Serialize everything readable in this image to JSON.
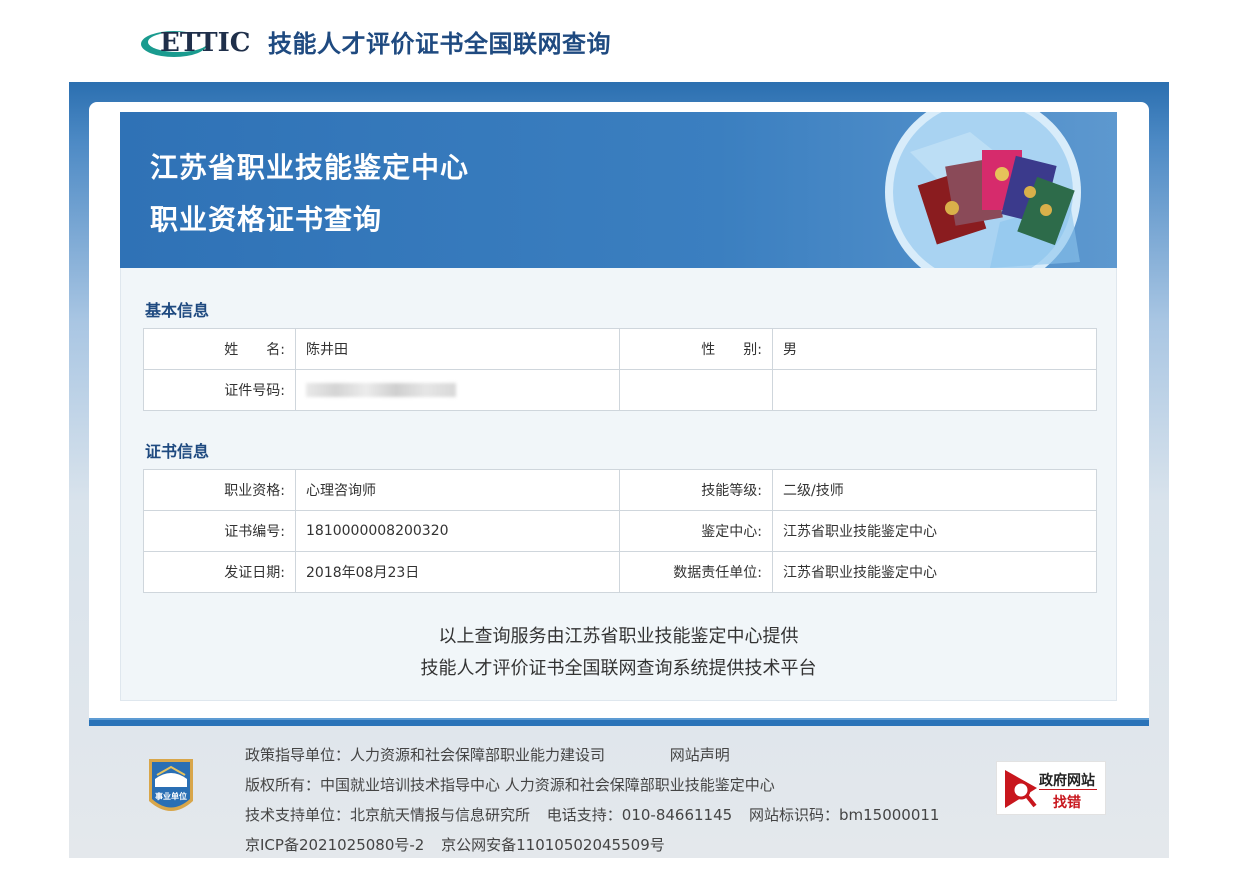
{
  "header": {
    "logo_text": "ETTIC",
    "site_title": "技能人才评价证书全国联网查询"
  },
  "banner": {
    "title_line1": "江苏省职业技能鉴定中心",
    "title_line2": "职业资格证书查询"
  },
  "basic_info": {
    "section_title": "基本信息",
    "name_label": "姓　　名:",
    "name_value": "陈井田",
    "gender_label": "性　　别:",
    "gender_value": "男",
    "id_label": "证件号码:"
  },
  "cert_info": {
    "section_title": "证书信息",
    "rows": [
      {
        "label1": "职业资格:",
        "value1": "心理咨询师",
        "label2": "技能等级:",
        "value2": "二级/技师"
      },
      {
        "label1": "证书编号:",
        "value1": "1810000008200320",
        "label2": "鉴定中心:",
        "value2": "江苏省职业技能鉴定中心"
      },
      {
        "label1": "发证日期:",
        "value1": "2018年08月23日",
        "label2": "数据责任单位:",
        "value2": "江苏省职业技能鉴定中心"
      }
    ]
  },
  "provider": {
    "line1": "以上查询服务由江苏省职业技能鉴定中心提供",
    "line2": "技能人才评价证书全国联网查询系统提供技术平台"
  },
  "footer": {
    "badge_text": "事业单位",
    "policy_unit": "政策指导单位：人力资源和社会保障部职业能力建设司",
    "site_statement": "网站声明",
    "copyright": "版权所有：中国就业培训技术指导中心  人力资源和社会保障部职业技能鉴定中心",
    "tech_support": "技术支持单位：北京航天情报与信息研究所",
    "phone": "电话支持：010-84661145",
    "site_code": "网站标识码：bm15000011",
    "icp": "京ICP备2021025080号-2",
    "police": "京公网安备11010502045509号",
    "gov_badge_line1": "政府网站",
    "gov_badge_line2": "找错"
  },
  "colors": {
    "brand_blue": "#1f4a80",
    "banner_blue": "#2f72b6",
    "footer_bar": "#2a73b8",
    "error_red": "#c8161d"
  }
}
